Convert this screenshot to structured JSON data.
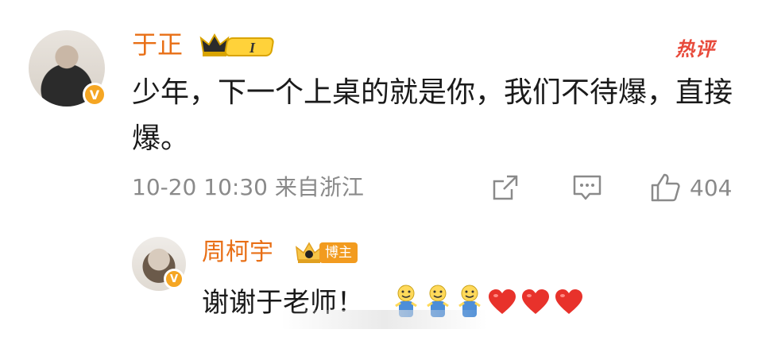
{
  "comment": {
    "username": "于正",
    "level_badge": "I",
    "hot_tag": "热评",
    "text": "少年，下一个上桌的就是你，我们不待爆，直接爆。",
    "time_location": "10-20 10:30 来自浙江",
    "like_count": "404",
    "icons": [
      "share-icon",
      "comment-icon",
      "like-icon"
    ]
  },
  "reply": {
    "username": "周柯宇",
    "badge_label": "博主",
    "text": "谢谢于老师！",
    "emojis": [
      "doge-emoji",
      "doge-emoji",
      "doge-emoji",
      "heart-emoji",
      "heart-emoji",
      "heart-emoji"
    ]
  },
  "colors": {
    "username": "#e86f16",
    "hot": "#e84a3b",
    "meta": "#8a8a8a",
    "verified": "#f5a623"
  }
}
